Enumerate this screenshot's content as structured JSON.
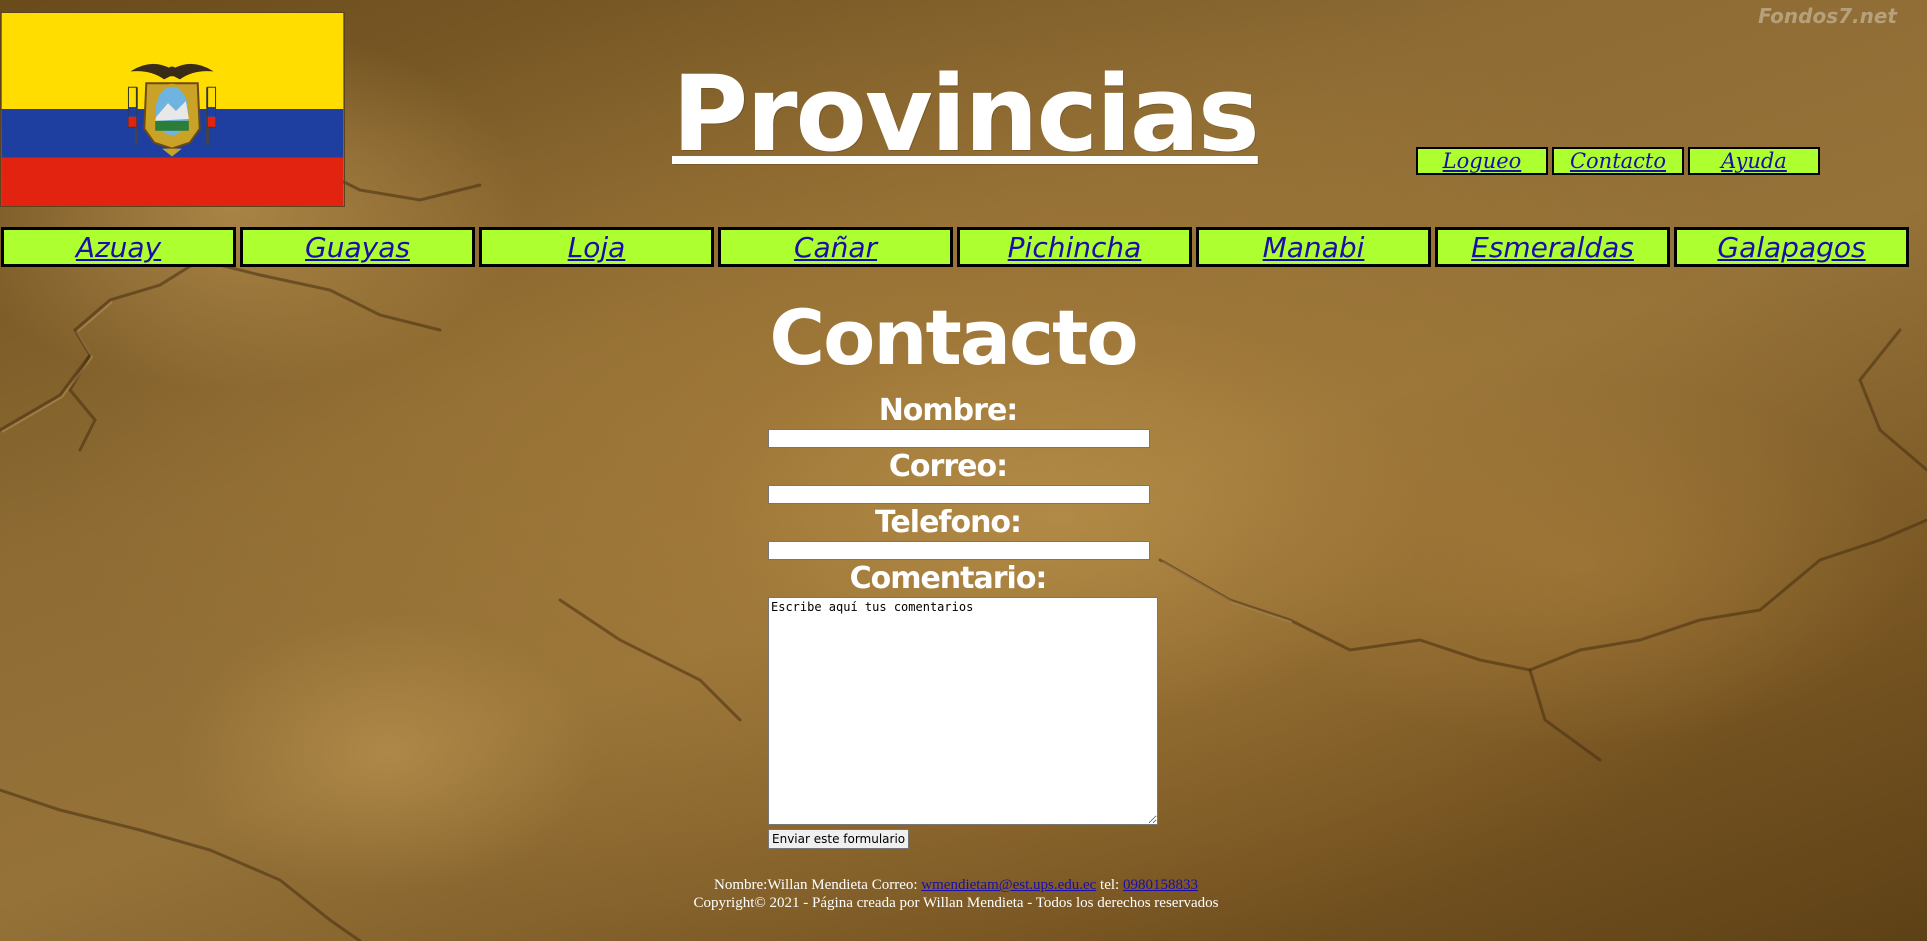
{
  "watermark": "Fondos7.net",
  "header": {
    "title": "Provincias"
  },
  "top_nav": [
    {
      "label": "Logueo"
    },
    {
      "label": "Contacto"
    },
    {
      "label": "Ayuda"
    }
  ],
  "province_nav": [
    {
      "label": "Azuay"
    },
    {
      "label": "Guayas"
    },
    {
      "label": "Loja"
    },
    {
      "label": "Cañar"
    },
    {
      "label": "Pichincha"
    },
    {
      "label": "Manabi"
    },
    {
      "label": "Esmeraldas"
    },
    {
      "label": "Galapagos"
    }
  ],
  "contact_form": {
    "title": "Contacto",
    "name_label": "Nombre:",
    "email_label": "Correo:",
    "phone_label": "Telefono:",
    "comment_label": "Comentario:",
    "comment_value": "Escribe aquí tus comentarios",
    "submit_label": "Enviar este formulario"
  },
  "footer": {
    "name_text": "Nombre:Willan Mendieta Correo: ",
    "email_link": "wmendietam@est.ups.edu.ec",
    "phone_prefix": " tel: ",
    "phone_link": "0980158833",
    "copyright": "Copyright© 2021 - Página creada por Willan Mendieta - Todos los derechos reservados"
  },
  "colors": {
    "nav_background": "#adff2f",
    "link": "#1a0dab",
    "flag_yellow": "#ffdd00",
    "flag_blue": "#1e3fa0",
    "flag_red": "#e2230f"
  },
  "icons": {
    "flag": "ecuador-flag"
  }
}
